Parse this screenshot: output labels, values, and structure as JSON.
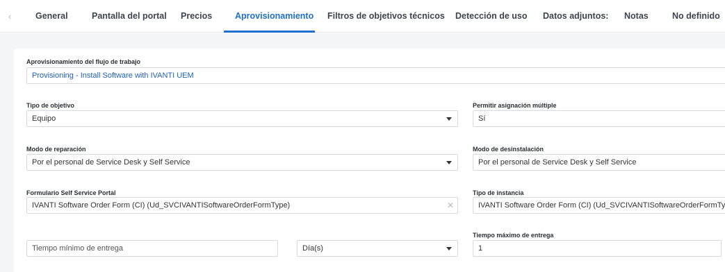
{
  "tabs": [
    {
      "label": "General"
    },
    {
      "label": "Pantalla del portal"
    },
    {
      "label": "Precios"
    },
    {
      "label": "Aprovisionamiento",
      "active": true
    },
    {
      "label": "Filtros de objetivos técnicos"
    },
    {
      "label": "Detección de uso"
    },
    {
      "label": "Datos adjuntos:"
    },
    {
      "label": "Notas"
    },
    {
      "label": "No definido"
    }
  ],
  "form": {
    "workflow": {
      "label": "Aprovisionamiento del flujo de trabajo",
      "value": "Provisioning - Install Software with IVANTI UEM"
    },
    "target_type": {
      "label": "Tipo de objetivo",
      "value": "Equipo"
    },
    "multi_assign": {
      "label": "Permitir asignación múltiple",
      "value": "Sí"
    },
    "repair_mode": {
      "label": "Modo de reparación",
      "value": "Por el personal de Service Desk y Self Service"
    },
    "uninstall_mode": {
      "label": "Modo de desinstalación",
      "value": "Por el personal de Service Desk y Self Service"
    },
    "ssp_form": {
      "label": "Formulario Self Service Portal",
      "value": "IVANTI Software Order Form (CI) (Ud_SVCIVANTISoftwareOrderFormType)"
    },
    "instance_type": {
      "label": "Tipo de instancia",
      "value": "IVANTI Software Order Form (CI) (Ud_SVCIVANTISoftwareOrderFormType)"
    },
    "min_delivery": {
      "placeholder": "Tiempo mínimo de entrega",
      "unit": "Día(s)"
    },
    "max_delivery": {
      "label": "Tiempo máximo de entrega",
      "value": "1"
    }
  },
  "icons": {
    "tab_scroll_left": "chevron-left-icon",
    "dropdown": "caret-down-icon",
    "clear": "close-icon"
  },
  "colors": {
    "accent": "#1f6fd1",
    "link": "#1f5fbf",
    "background": "#f4f5f7"
  }
}
